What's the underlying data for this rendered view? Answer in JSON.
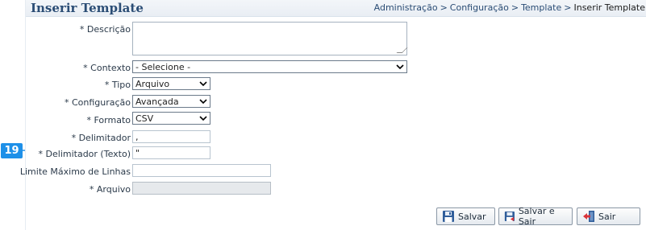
{
  "page": {
    "title": "Inserir Template",
    "breadcrumb": [
      "Administração",
      "Configuração",
      "Template",
      "Inserir Template"
    ],
    "breadcrumb_sep": ">"
  },
  "callout": {
    "number": "19"
  },
  "form": {
    "descricao": {
      "label": "* Descrição",
      "value": ""
    },
    "contexto": {
      "label": "* Contexto",
      "value": "- Selecione -"
    },
    "tipo": {
      "label": "* Tipo",
      "value": "Arquivo"
    },
    "configuracao": {
      "label": "* Configuração",
      "value": "Avançada"
    },
    "formato": {
      "label": "* Formato",
      "value": "CSV"
    },
    "delimitador": {
      "label": "* Delimitador",
      "value": ","
    },
    "delimitador_texto": {
      "label": "* Delimitador (Texto)",
      "value": "\""
    },
    "limite_linhas": {
      "label": "Limite Máximo de Linhas",
      "value": ""
    },
    "arquivo": {
      "label": "* Arquivo",
      "value": ""
    }
  },
  "buttons": {
    "salvar": "Salvar",
    "salvar_sair": "Salvar e Sair",
    "sair": "Sair"
  },
  "colors": {
    "title": "#2b4d75",
    "callout": "#1e90e8"
  }
}
